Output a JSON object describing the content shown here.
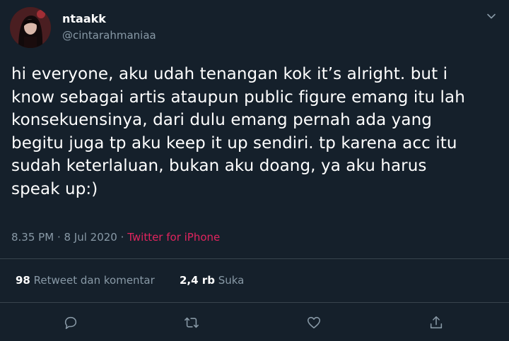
{
  "author": {
    "name": "ntaakk",
    "handle": "@cintarahmaniaa"
  },
  "tweet": {
    "text": "hi everyone, aku udah tenangan kok it’s alright. but i\nknow sebagai artis ataupun public figure emang itu lah\nkonsekuensinya, dari dulu emang pernah ada yang\nbegitu juga tp aku keep it up sendiri. tp karena acc itu\nsudah keterlaluan, bukan aku doang, ya aku harus\nspeak up:)",
    "time": "8.35 PM",
    "separator": "·",
    "date": "8 Jul 2020",
    "source": "Twitter for iPhone"
  },
  "stats": {
    "retweets_count": "98",
    "retweets_label": "Retweet dan komentar",
    "likes_count": "2,4 rb",
    "likes_label": "Suka"
  },
  "icons": {
    "caret": "chevron-down-icon",
    "reply": "reply-icon",
    "retweet": "retweet-icon",
    "like": "heart-icon",
    "share": "share-icon"
  },
  "colors": {
    "background": "#15202b",
    "secondary_text": "#8899a6",
    "source_link": "#e0245e",
    "divider": "#38444d"
  }
}
